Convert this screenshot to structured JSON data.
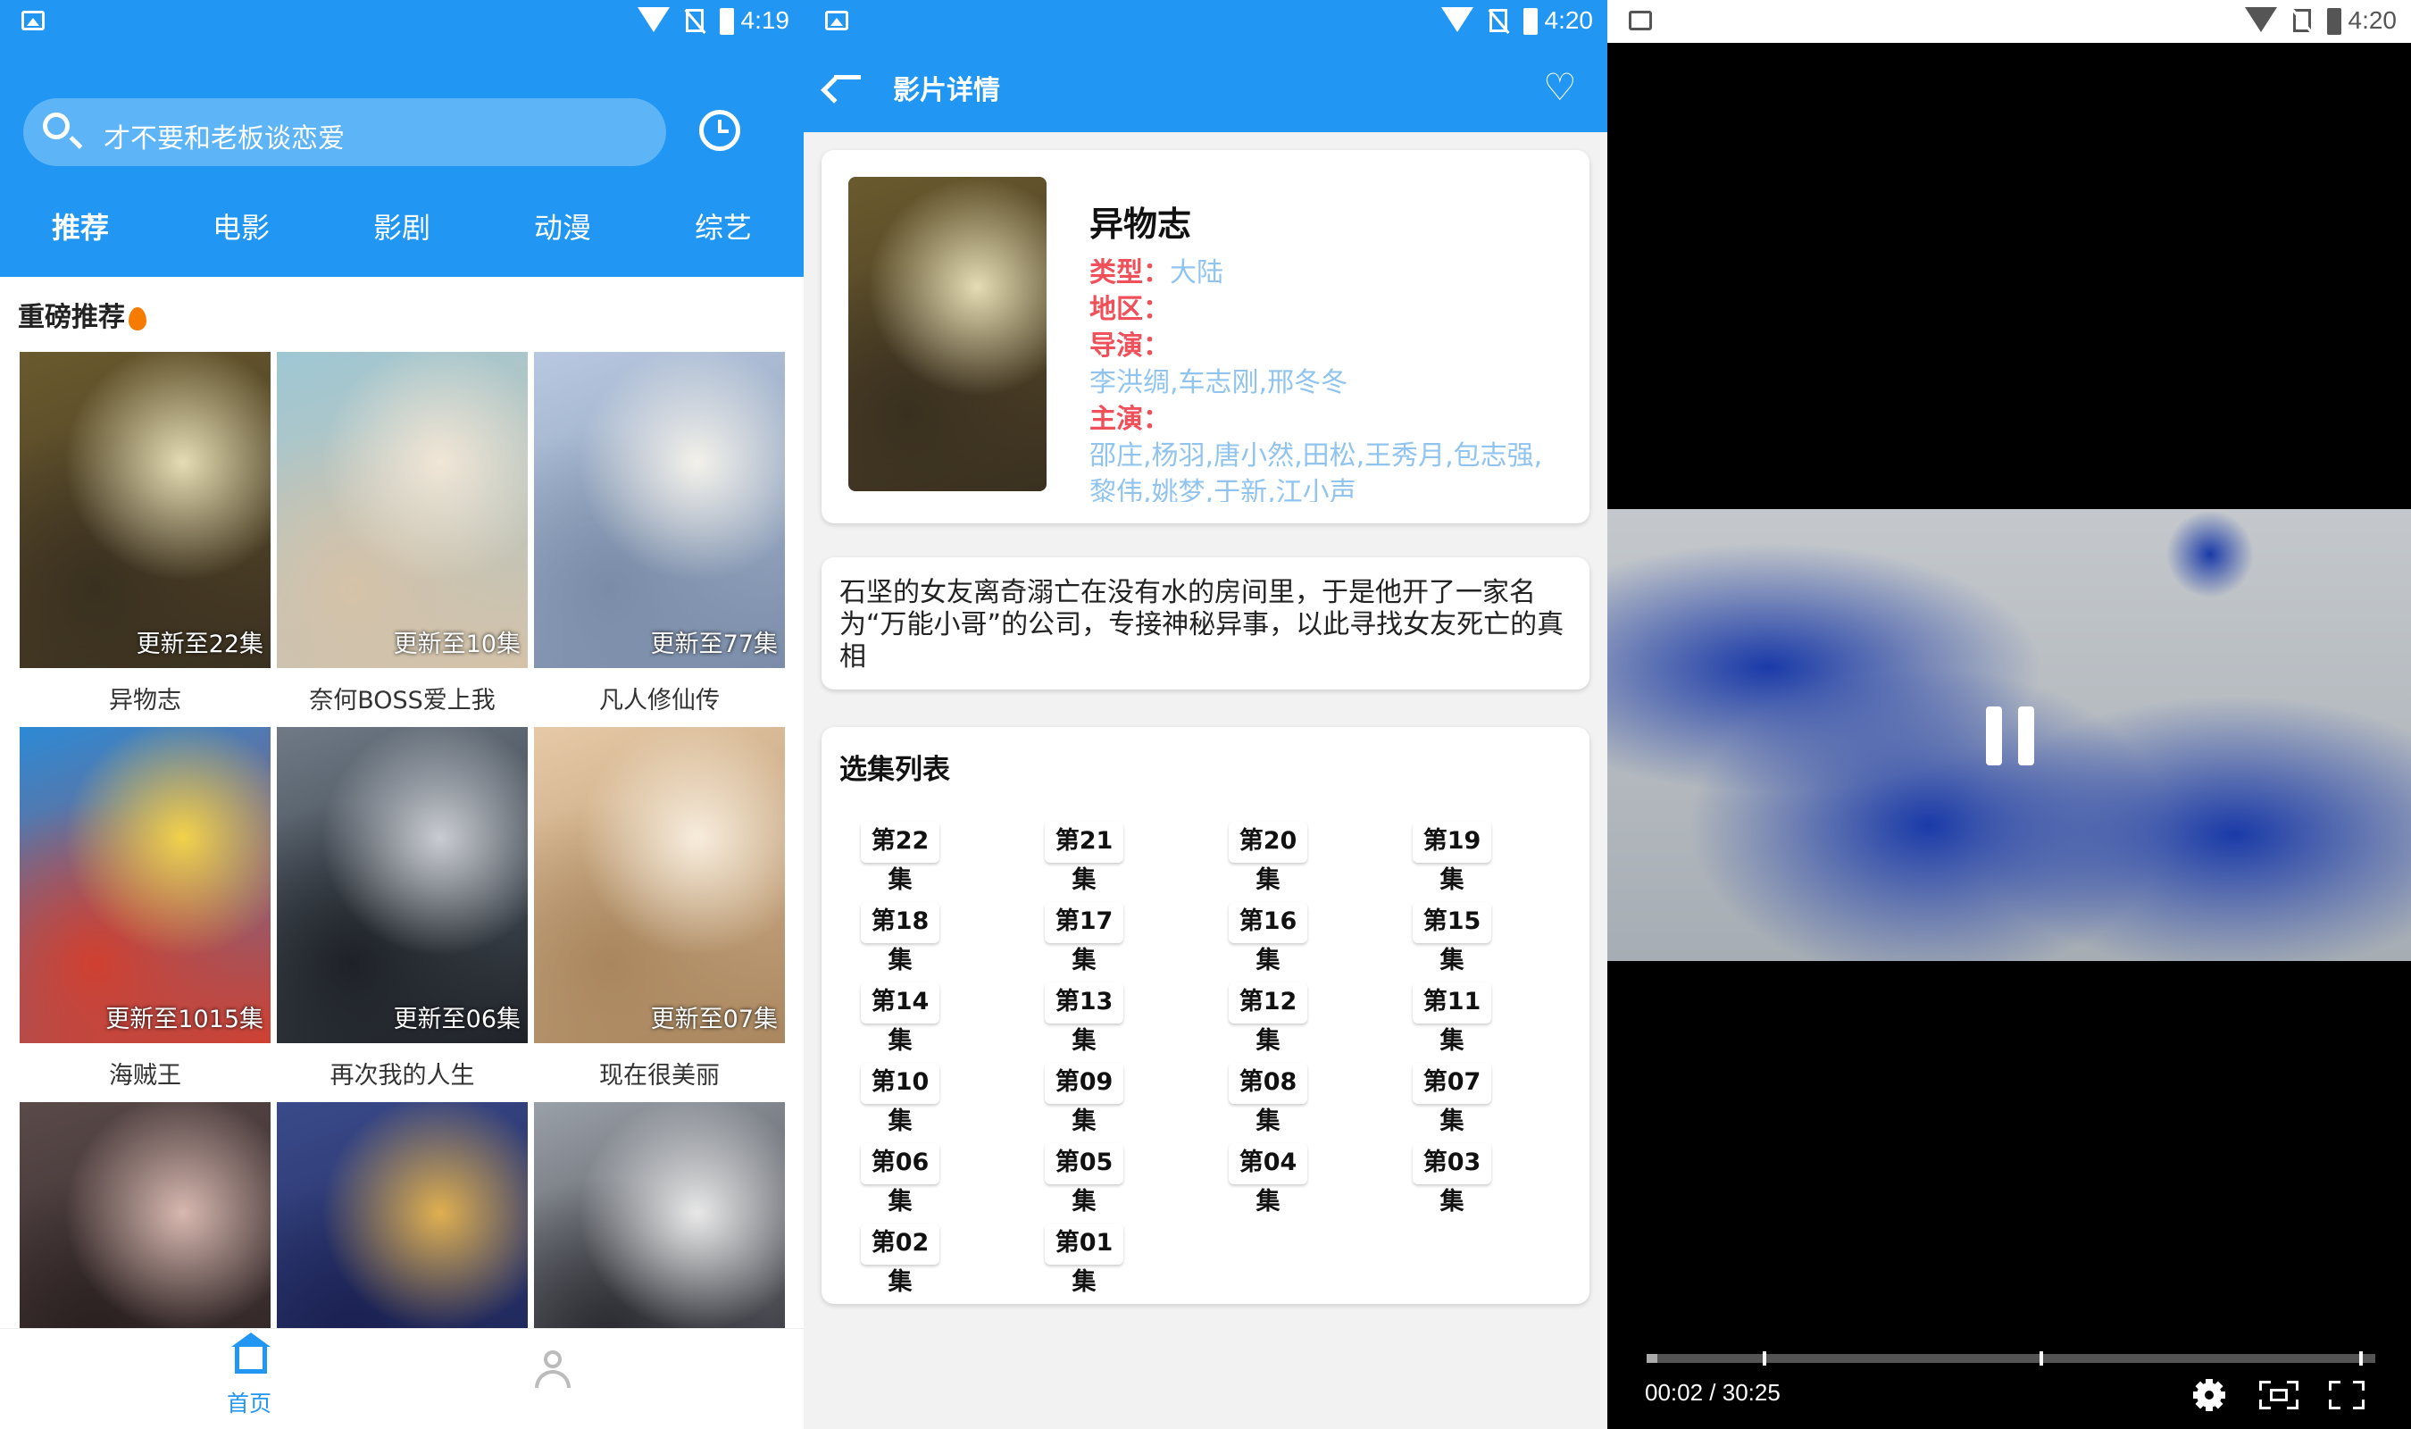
{
  "status_bars": [
    {
      "time": "4:19"
    },
    {
      "time": "4:20"
    },
    {
      "time": "4:20"
    }
  ],
  "home": {
    "search_text": "才不要和老板谈恋爱",
    "tabs": [
      "推荐",
      "电影",
      "影剧",
      "动漫",
      "综艺"
    ],
    "section_title": "重磅推荐",
    "cards": [
      {
        "title": "异物志",
        "update": "更新至22集",
        "palette": [
          "#6a5a2e",
          "#e4dcb4",
          "#3a3020"
        ]
      },
      {
        "title": "奈何BOSS爱上我",
        "update": "更新至10集",
        "palette": [
          "#9ec7d4",
          "#f1e6d6",
          "#d5c2a8"
        ]
      },
      {
        "title": "凡人修仙传",
        "update": "更新至77集",
        "palette": [
          "#b8c8e0",
          "#f3f1ea",
          "#7a8ca8"
        ]
      },
      {
        "title": "海贼王",
        "update": "更新至1015集",
        "palette": [
          "#2c8ad6",
          "#f3d24a",
          "#d04030"
        ]
      },
      {
        "title": "再次我的人生",
        "update": "更新至06集",
        "palette": [
          "#6f7a86",
          "#c9ccd2",
          "#1e2228"
        ]
      },
      {
        "title": "现在很美丽",
        "update": "更新至07集",
        "palette": [
          "#e6c9a6",
          "#f7ecdc",
          "#a9865e"
        ]
      },
      {
        "title": "",
        "update": "",
        "palette": [
          "#5a4a4a",
          "#d8b8b0",
          "#2a2020"
        ]
      },
      {
        "title": "",
        "update": "",
        "palette": [
          "#3a4a8a",
          "#e0b050",
          "#1a2050"
        ]
      },
      {
        "title": "",
        "update": "",
        "palette": [
          "#9aa0a8",
          "#e8e8e8",
          "#2a2a30"
        ]
      }
    ],
    "bottom_nav": {
      "home_label": "首页"
    }
  },
  "detail": {
    "header_title": "影片详情",
    "name": "异物志",
    "type_label": "类型：",
    "type_value": "大陆",
    "region_label": "地区：",
    "director_label": "导演：",
    "director_value": "李洪绸,车志刚,邢冬冬",
    "cast_label": "主演：",
    "cast_value": "邵庄,杨羽,唐小然,田松,王秀月,包志强,黎伟,姚梦,于新,江小声",
    "description": "石坚的女友离奇溺亡在没有水的房间里，于是他开了一家名为“万能小哥”的公司，专接神秘异事，以此寻找女友死亡的真相",
    "episodes_title": "选集列表",
    "episodes": [
      "第22集",
      "第21集",
      "第20集",
      "第19集",
      "第18集",
      "第17集",
      "第16集",
      "第15集",
      "第14集",
      "第13集",
      "第12集",
      "第11集",
      "第10集",
      "第09集",
      "第08集",
      "第07集",
      "第06集",
      "第05集",
      "第04集",
      "第03集",
      "第02集",
      "第01集"
    ]
  },
  "player": {
    "time_display": "00:02 / 30:25",
    "progress_fraction": 0.0011,
    "video_tint": "#1a3aa8"
  },
  "colors": {
    "primary": "#2196f3",
    "label_red": "#f0505a",
    "value_blue": "#90c4ee"
  }
}
